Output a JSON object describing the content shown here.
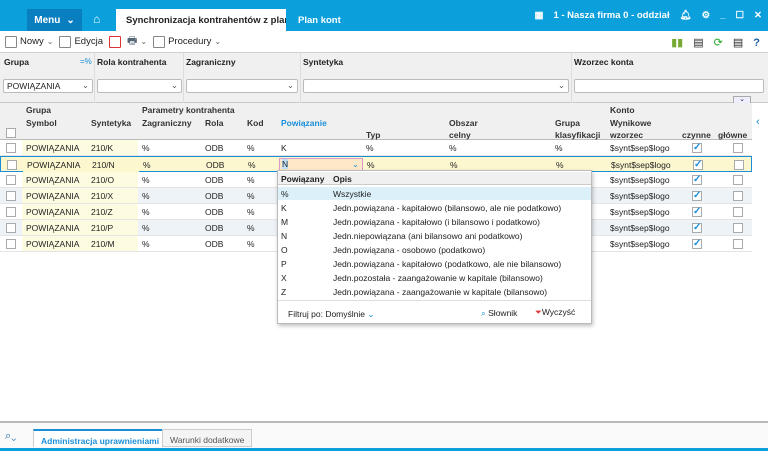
{
  "topbar": {
    "menu": "Menu",
    "active_tab": "Synchronizacja kontrahentów z plan",
    "tab2": "Plan kont",
    "company": "1 - Nasza firma 0 - oddział"
  },
  "toolbar": {
    "new": "Nowy",
    "edit": "Edycja",
    "procedures": "Procedury"
  },
  "filters": {
    "grupa_label": "Grupa",
    "grupa_value": "POWIĄZANIA",
    "rola_label": "Rola kontrahenta",
    "zagr_label": "Zagraniczny",
    "synt_label": "Syntetyka",
    "wzorzec_label": "Wzorzec konta"
  },
  "grid": {
    "h_grupa": "Grupa",
    "h_params": "Parametry kontrahenta",
    "h_konto": "Konto",
    "h_symbol": "Symbol",
    "h_syntetyka": "Syntetyka",
    "h_zagr": "Zagraniczny",
    "h_rola": "Rola",
    "h_kod": "Kod",
    "h_powiazanie": "Powiązanie",
    "h_obszar": "Obszar",
    "h_grupa_k": "Grupa",
    "h_wynikowe": "Wynikowe",
    "h_typ": "Typ",
    "h_celny": "celny",
    "h_klasyf": "klasyfikacji",
    "h_wzorzec": "wzorzec",
    "h_czynne": "czynne",
    "h_glowne": "główne",
    "rows": [
      {
        "symbol": "POWIĄZANIA",
        "synt": "210/K",
        "zagr": "%",
        "rola": "ODB",
        "kod": "%",
        "pow": "K",
        "typ": "%",
        "celny": "%",
        "klas": "%",
        "wzorzec": "$synt$sep$logo",
        "czynne": true,
        "glowne": false
      },
      {
        "symbol": "POWIĄZANIA",
        "synt": "210/N",
        "zagr": "%",
        "rola": "ODB",
        "kod": "%",
        "pow": "N",
        "typ": "%",
        "celny": "%",
        "klas": "%",
        "wzorzec": "$synt$sep$logo",
        "czynne": true,
        "glowne": false
      },
      {
        "symbol": "POWIĄZANIA",
        "synt": "210/O",
        "zagr": "%",
        "rola": "ODB",
        "kod": "%",
        "pow": "",
        "typ": "",
        "celny": "",
        "klas": "",
        "wzorzec": "$synt$sep$logo",
        "czynne": true,
        "glowne": false
      },
      {
        "symbol": "POWIĄZANIA",
        "synt": "210/X",
        "zagr": "%",
        "rola": "ODB",
        "kod": "%",
        "pow": "",
        "typ": "",
        "celny": "",
        "klas": "",
        "wzorzec": "$synt$sep$logo",
        "czynne": true,
        "glowne": false
      },
      {
        "symbol": "POWIĄZANIA",
        "synt": "210/Z",
        "zagr": "%",
        "rola": "ODB",
        "kod": "%",
        "pow": "",
        "typ": "",
        "celny": "",
        "klas": "",
        "wzorzec": "$synt$sep$logo",
        "czynne": true,
        "glowne": false
      },
      {
        "symbol": "POWIĄZANIA",
        "synt": "210/P",
        "zagr": "%",
        "rola": "ODB",
        "kod": "%",
        "pow": "",
        "typ": "",
        "celny": "",
        "klas": "",
        "wzorzec": "$synt$sep$logo",
        "czynne": true,
        "glowne": false
      },
      {
        "symbol": "POWIĄZANIA",
        "synt": "210/M",
        "zagr": "%",
        "rola": "ODB",
        "kod": "%",
        "pow": "",
        "typ": "",
        "celny": "",
        "klas": "",
        "wzorzec": "$synt$sep$logo",
        "czynne": true,
        "glowne": false
      }
    ]
  },
  "popup": {
    "h_code": "Powiązany",
    "h_desc": "Opis",
    "items": [
      {
        "code": "%",
        "desc": "Wszystkie"
      },
      {
        "code": "K",
        "desc": "Jedn.powiązana - kapitałowo (bilansowo, ale nie podatkowo)"
      },
      {
        "code": "M",
        "desc": "Jedn.powiązana - kapitałowo (i bilansowo i podatkowo)"
      },
      {
        "code": "N",
        "desc": "Jedn.niepowiązana (ani bilansowo ani podatkowo)"
      },
      {
        "code": "O",
        "desc": "Jedn.powiązana - osobowo (podatkowo)"
      },
      {
        "code": "P",
        "desc": "Jedn.powiązana - kapitałowo (podatkowo, ale nie bilansowo)"
      },
      {
        "code": "X",
        "desc": "Jedn.pozostała - zaangażowanie w kapitale (bilansowo)"
      },
      {
        "code": "Z",
        "desc": "Jedn.powiązana - zaangażowanie w kapitale (bilansowo)"
      }
    ],
    "filter": "Filtruj po: Domyślnie",
    "slownik": "Słownik",
    "clear": "Wyczyść"
  },
  "bottom": {
    "tab1": "Administracja uprawnieniami",
    "tab2": "Warunki dodatkowe"
  },
  "colors": {
    "accent": "#0b9fdc",
    "selected_row": "#fdf7d0",
    "highlight": "#dcf0fa"
  }
}
